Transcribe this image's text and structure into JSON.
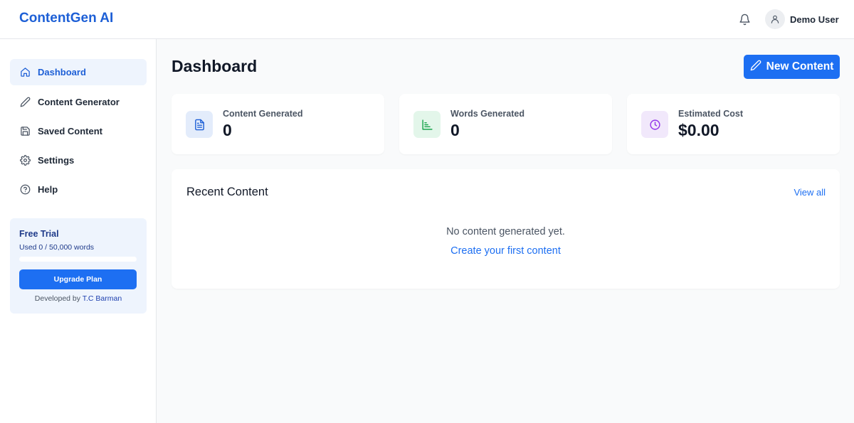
{
  "header": {
    "brand": "ContentGen AI",
    "notification_icon": "bell-icon",
    "user_icon": "user-icon",
    "user_name": "Demo User"
  },
  "sidebar": {
    "items": [
      {
        "label": "Dashboard",
        "icon": "home-icon",
        "active": true
      },
      {
        "label": "Content Generator",
        "icon": "pencil-icon",
        "active": false
      },
      {
        "label": "Saved Content",
        "icon": "save-icon",
        "active": false
      },
      {
        "label": "Settings",
        "icon": "gear-icon",
        "active": false
      },
      {
        "label": "Help",
        "icon": "help-circle-icon",
        "active": false
      }
    ],
    "trial": {
      "title": "Free Trial",
      "usage": "Used 0 / 50,000 words",
      "progress": 0,
      "button": "Upgrade Plan",
      "credit_prefix": "Developed by",
      "credit_author": "T.C Barman"
    }
  },
  "main": {
    "title": "Dashboard",
    "new_button": "New Content",
    "stats": [
      {
        "label": "Content Generated",
        "value": "0",
        "icon": "document-icon",
        "color": "#e3ecfb"
      },
      {
        "label": "Words Generated",
        "value": "0",
        "icon": "bar-chart-icon",
        "color": "#e3f6ea"
      },
      {
        "label": "Estimated Cost",
        "value": "$0.00",
        "icon": "clock-icon",
        "color": "#f1e8fb"
      }
    ],
    "recent": {
      "title": "Recent Content",
      "view_all": "View all",
      "empty": "No content generated yet.",
      "create_link": "Create your first content"
    }
  },
  "colors": {
    "brand": "#1d5fd6",
    "primary": "#1d6ff2"
  }
}
